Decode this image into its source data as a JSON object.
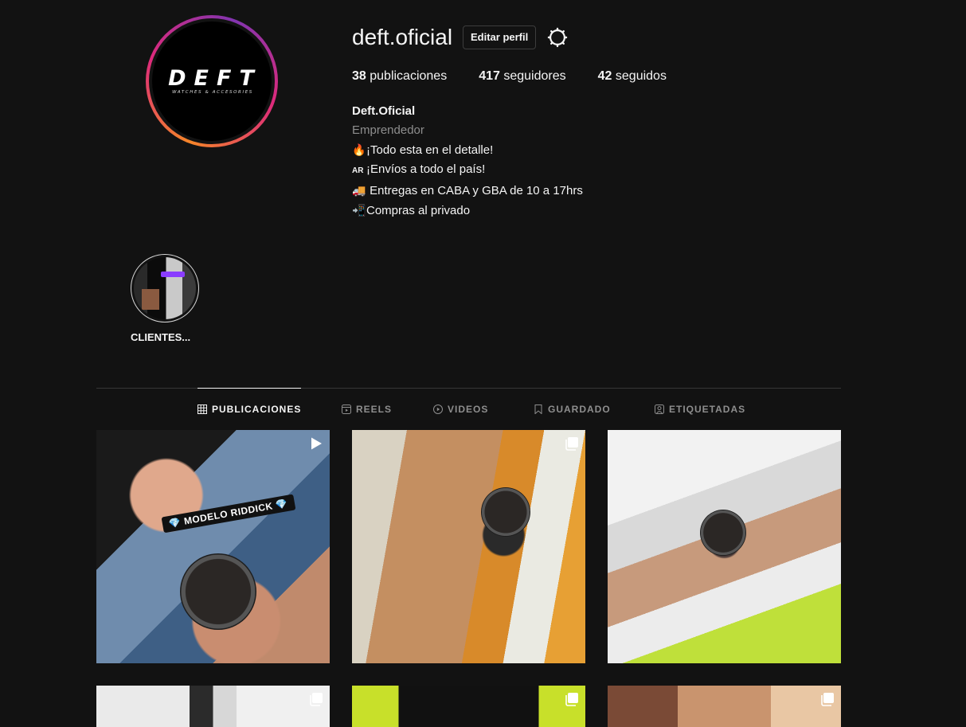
{
  "profile": {
    "username": "deft.oficial",
    "edit_button": "Editar perfil",
    "logo_main": "DEFT",
    "logo_sub": "WATCHES & ACCESORIES"
  },
  "stats": {
    "posts_count": "38",
    "posts_label": "publicaciones",
    "followers_count": "417",
    "followers_label": "seguidores",
    "following_count": "42",
    "following_label": "seguidos"
  },
  "bio": {
    "name": "Deft.Oficial",
    "category": "Emprendedor",
    "line1_icon": "🔥",
    "line1": "¡Todo esta en el detalle!",
    "line2_icon": "AR",
    "line2": "¡Envíos a todo el país!",
    "line3_icon": "🚚",
    "line3": "Entregas en CABA y GBA de 10 a 17hrs",
    "line4_icon": "📲",
    "line4": "Compras al privado"
  },
  "highlights": [
    {
      "label": "CLIENTES..."
    }
  ],
  "tabs": [
    {
      "label": "PUBLICACIONES",
      "icon": "grid-icon",
      "active": true
    },
    {
      "label": "REELS",
      "icon": "reels-icon",
      "active": false
    },
    {
      "label": "VIDEOS",
      "icon": "play-circle-icon",
      "active": false
    },
    {
      "label": "GUARDADO",
      "icon": "bookmark-icon",
      "active": false
    },
    {
      "label": "ETIQUETADAS",
      "icon": "tagged-person-icon",
      "active": false
    }
  ],
  "posts": [
    {
      "type": "reel",
      "sticker": "💎 MODELO RIDDICK 💎"
    },
    {
      "type": "carousel"
    },
    {
      "type": "photo"
    },
    {
      "type": "carousel"
    },
    {
      "type": "carousel"
    },
    {
      "type": "carousel"
    }
  ]
}
